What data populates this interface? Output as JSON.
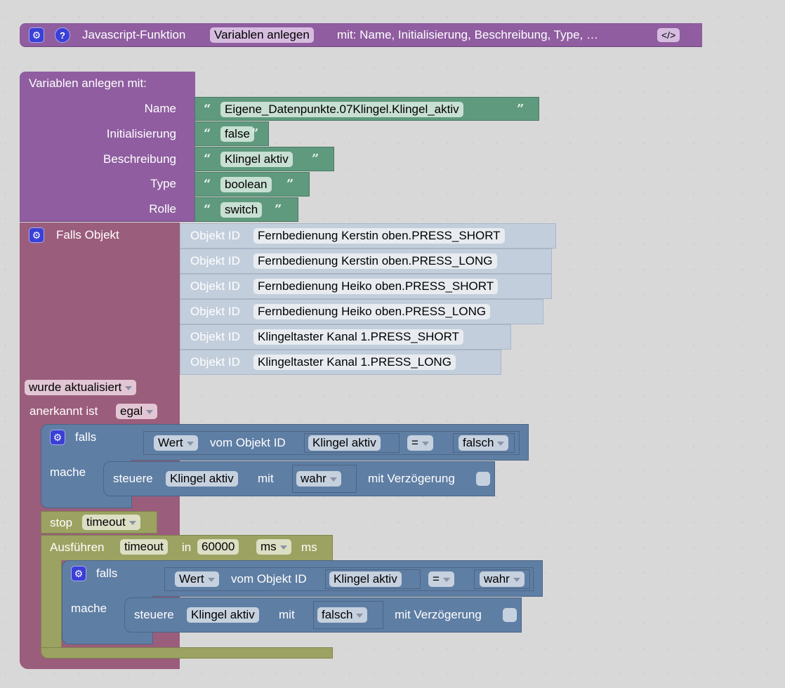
{
  "function_block": {
    "prefix": "Javascript-Funktion",
    "function_name": "Variablen anlegen",
    "suffix": "mit: Name, Initialisierung, Beschreibung, Type, …",
    "code_button": "</>",
    "icons": [
      "gear-icon",
      "help-icon"
    ]
  },
  "variables_block": {
    "title": "Variablen anlegen  mit:",
    "params": [
      {
        "label": "Name",
        "value": "Eigene_Datenpunkte.07Klingel.Klingel_aktiv"
      },
      {
        "label": "Initialisierung",
        "value": "false"
      },
      {
        "label": "Beschreibung",
        "value": "Klingel aktiv"
      },
      {
        "label": "Type",
        "value": "boolean"
      },
      {
        "label": "Rolle",
        "value": "switch"
      }
    ],
    "open_quote": "“",
    "close_quote": "”"
  },
  "trigger_block": {
    "title": "Falls Objekt",
    "object_label": "Objekt ID",
    "objects": [
      "Fernbedienung Kerstin oben.PRESS_SHORT",
      "Fernbedienung Kerstin oben.PRESS_LONG",
      "Fernbedienung Heiko oben.PRESS_SHORT",
      "Fernbedienung Heiko oben.PRESS_LONG",
      "Klingeltaster Kanal 1.PRESS_SHORT",
      "Klingeltaster Kanal 1.PRESS_LONG"
    ],
    "event": "wurde aktualisiert",
    "ack_label": "anerkannt ist",
    "ack_value": "egal"
  },
  "if_block_1": {
    "if_label": "falls",
    "do_label": "mache",
    "value_dropdown": "Wert",
    "from_object_label": "vom Objekt ID",
    "object": "Klingel aktiv",
    "operator": "=",
    "compare_value": "falsch",
    "set_label": "steuere",
    "set_object": "Klingel aktiv",
    "with_label": "mit",
    "set_value": "wahr",
    "delay_label": "mit Verzögerung",
    "delay_checked": false
  },
  "stop_block": {
    "label": "stop",
    "timer": "timeout"
  },
  "timeout_block": {
    "label": "Ausführen",
    "timer": "timeout",
    "in_label": "in",
    "duration": "60000",
    "unit_dropdown": "ms",
    "unit_label": "ms"
  },
  "if_block_2": {
    "if_label": "falls",
    "do_label": "mache",
    "value_dropdown": "Wert",
    "from_object_label": "vom Objekt ID",
    "object": "Klingel aktiv",
    "operator": "=",
    "compare_value": "wahr",
    "set_label": "steuere",
    "set_object": "Klingel aktiv",
    "with_label": "mit",
    "set_value": "falsch",
    "delay_label": "mit Verzögerung",
    "delay_checked": false
  },
  "colors": {
    "procedure": "#8f5da0",
    "trigger": "#9b5d7c",
    "text": "#5f9a7e",
    "object_id": "#c3cedc",
    "logic": "#5f7ea4",
    "timeout": "#9ca261",
    "gear_button": "#3a3fd6"
  }
}
